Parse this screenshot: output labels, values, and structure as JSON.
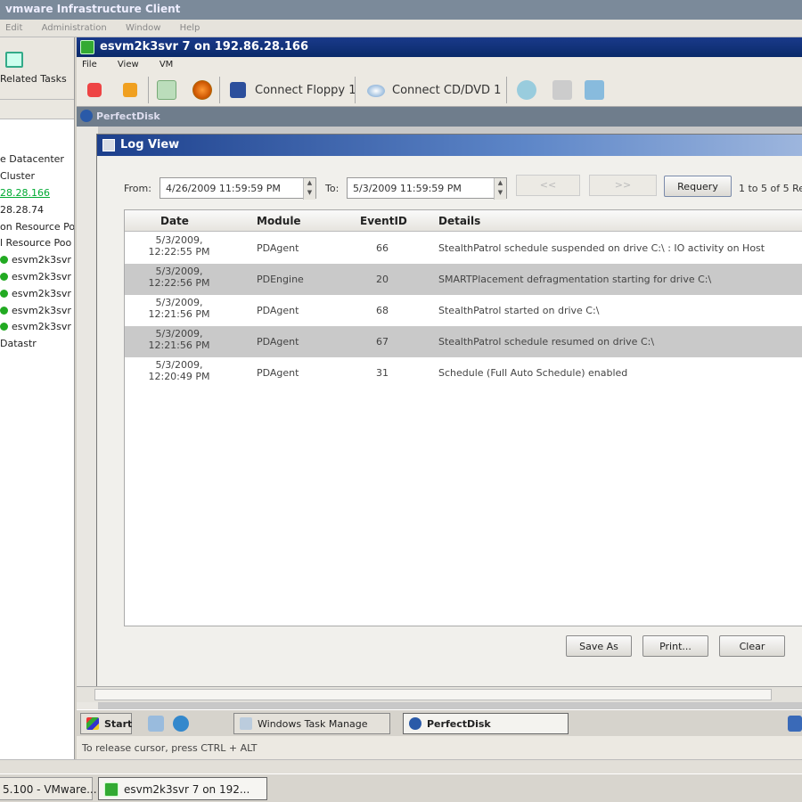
{
  "outer_window": {
    "title": "vmware Infrastructure Client",
    "menu": [
      "Edit",
      "Administration",
      "Window",
      "Help"
    ]
  },
  "left_panel": {
    "related_tasks_label": "Related Tasks",
    "tree": [
      "e Datacenter",
      "Cluster",
      "28.28.166",
      "28.28.74",
      "on Resource Po",
      "l Resource Poo",
      "esvm2k3svr",
      "esvm2k3svr",
      "esvm2k3svr",
      "esvm2k3svr",
      "esvm2k3svr",
      "Datastr"
    ]
  },
  "vm_window": {
    "title": "esvm2k3svr 7 on 192.86.28.166",
    "menu": [
      "File",
      "View",
      "VM"
    ],
    "toolbar": {
      "connect_floppy": "Connect Floppy 1",
      "connect_cd": "Connect CD/DVD 1"
    },
    "status_text": "To release cursor, press CTRL + ALT"
  },
  "guest": {
    "perfectdisk_title": "PerfectDisk",
    "log_view": {
      "title": "Log View",
      "from_label": "From:",
      "from_value": "4/26/2009 11:59:59 PM",
      "to_label": "To:",
      "to_value": "5/3/2009 11:59:59 PM",
      "prev_button": "<<",
      "next_button": ">>",
      "requery_button": "Requery",
      "count_text": "1 to 5 of 5 Re",
      "columns": [
        "Date",
        "Module",
        "EventID",
        "Details"
      ],
      "rows": [
        {
          "date": "5/3/2009, 12:22:55 PM",
          "module": "PDAgent",
          "event_id": "66",
          "details": "StealthPatrol schedule suspended on drive C:\\ : IO activity on Host"
        },
        {
          "date": "5/3/2009, 12:22:56 PM",
          "module": "PDEngine",
          "event_id": "20",
          "details": "SMARTPlacement defragmentation starting for drive C:\\"
        },
        {
          "date": "5/3/2009, 12:21:56 PM",
          "module": "PDAgent",
          "event_id": "68",
          "details": "StealthPatrol started on drive C:\\"
        },
        {
          "date": "5/3/2009, 12:21:56 PM",
          "module": "PDAgent",
          "event_id": "67",
          "details": "StealthPatrol schedule resumed on drive C:\\"
        },
        {
          "date": "5/3/2009, 12:20:49 PM",
          "module": "PDAgent",
          "event_id": "31",
          "details": "Schedule (Full Auto Schedule) enabled"
        }
      ],
      "save_as_button": "Save As",
      "print_button": "Print...",
      "clear_button": "Clear"
    },
    "taskbar": {
      "start": "Start",
      "task_manager": "Windows Task Manage",
      "perfectdisk": "PerfectDisk"
    }
  },
  "host_taskbar": {
    "item1": "5.100 - VMware...",
    "item2": "esvm2k3svr 7 on 192..."
  }
}
